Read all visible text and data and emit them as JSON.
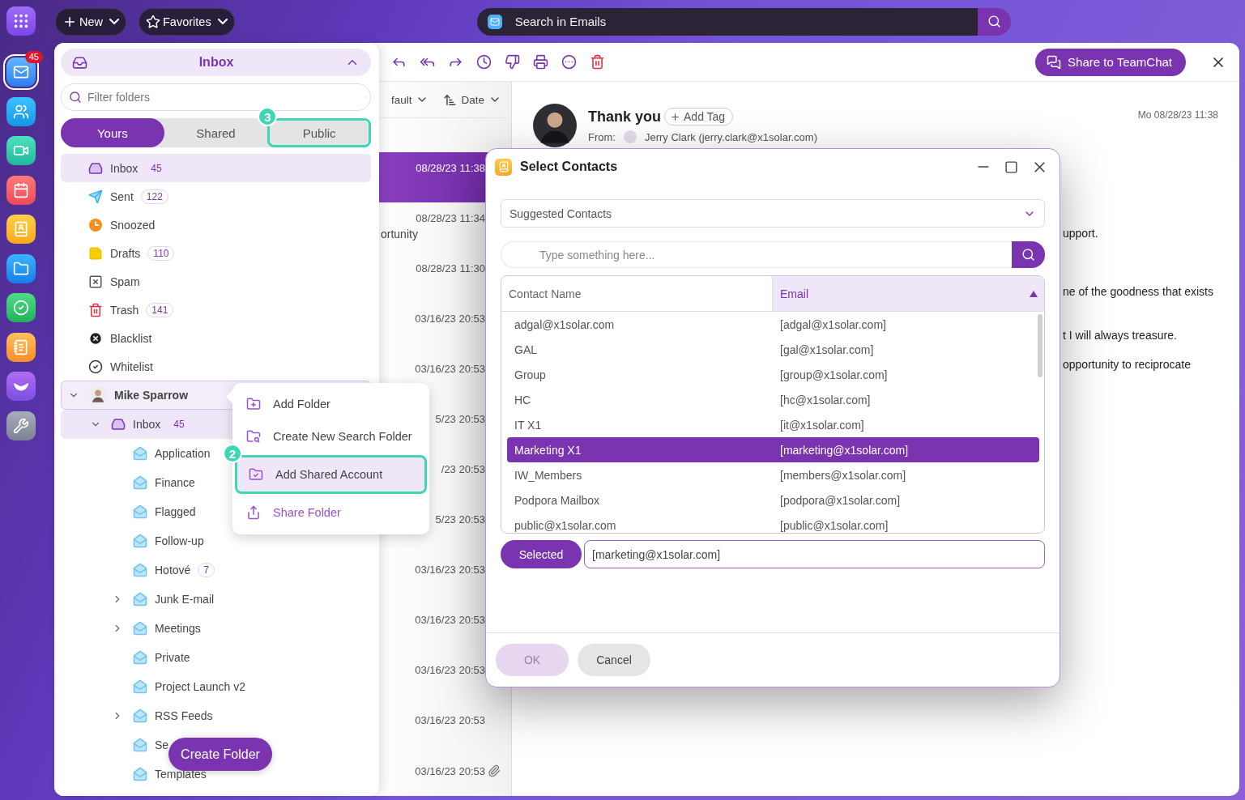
{
  "top_bar": {
    "new_label": "New",
    "favorites_label": "Favorites",
    "search_placeholder": "Search in Emails"
  },
  "app_rail": [
    {
      "kind": "mail",
      "selected": true,
      "badge": "45"
    },
    {
      "kind": "contacts",
      "selected": false
    },
    {
      "kind": "meetings",
      "selected": false
    },
    {
      "kind": "calendar",
      "selected": false
    },
    {
      "kind": "address_book",
      "selected": false
    },
    {
      "kind": "files",
      "selected": false
    },
    {
      "kind": "tasks",
      "selected": false
    },
    {
      "kind": "notes",
      "selected": false
    },
    {
      "kind": "stream",
      "selected": false
    },
    {
      "kind": "tools",
      "selected": false
    }
  ],
  "toolbar": {
    "share_button": "Share to TeamChat"
  },
  "message_list": {
    "view_filter": "fault",
    "sort_label": "Date",
    "rows": [
      {
        "date": "08/28/23 11:38",
        "selected": true
      },
      {
        "date": "08/28/23 11:34",
        "snippet": "ortunity",
        "selected": false
      },
      {
        "date": "08/28/23 11:30",
        "selected": false
      },
      {
        "date": "03/16/23 20:53",
        "selected": false
      },
      {
        "date": "03/16/23 20:53",
        "selected": false
      },
      {
        "date": "5/23 20:53",
        "selected": false
      },
      {
        "date": "/23 20:53",
        "selected": false
      },
      {
        "date": "5/23 20:53",
        "selected": false
      },
      {
        "date": "03/16/23 20:53",
        "selected": false
      },
      {
        "date": "03/16/23 20:53",
        "selected": false
      },
      {
        "date": "03/16/23 20:53",
        "selected": false
      },
      {
        "date": "03/16/23 20:53",
        "selected": false
      },
      {
        "date": "03/16/23 20:53",
        "selected": false,
        "attachment": true
      }
    ]
  },
  "reading_pane": {
    "subject": "Thank you",
    "add_tag": "Add Tag",
    "date": "Mo 08/28/23 11:38",
    "from_label": "From:",
    "from": "Jerry Clark (jerry.clark@x1solar.com)",
    "body_lines": [
      "upport.",
      "ne of the goodness that exists",
      "t I will always treasure.",
      "opportunity to reciprocate"
    ]
  },
  "folder_panel": {
    "title": "Inbox",
    "filter_placeholder": "Filter folders",
    "tabs": [
      {
        "label": "Yours",
        "selected": true
      },
      {
        "label": "Shared",
        "selected": false
      },
      {
        "label": "Public",
        "selected": false,
        "callout": "3"
      }
    ],
    "folders": [
      {
        "kind": "inbox",
        "label": "Inbox",
        "count": "45",
        "selected": true
      },
      {
        "kind": "sent",
        "label": "Sent",
        "count": "122",
        "selected": false
      },
      {
        "kind": "snoozed",
        "label": "Snoozed",
        "selected": false
      },
      {
        "kind": "drafts",
        "label": "Drafts",
        "count": "110",
        "selected": false
      },
      {
        "kind": "spam",
        "label": "Spam",
        "selected": false
      },
      {
        "kind": "trash",
        "label": "Trash",
        "count": "141",
        "selected": false
      },
      {
        "kind": "blacklist",
        "label": "Blacklist",
        "selected": false
      },
      {
        "kind": "whitelist",
        "label": "Whitelist",
        "selected": false
      }
    ],
    "accounts": [
      {
        "kind": "account",
        "label": "Mike Sparrow",
        "selected": true,
        "expanded": true,
        "children": [
          {
            "kind": "inbox",
            "label": "Inbox",
            "count": "45",
            "selected": true,
            "expanded": true,
            "children": [
              {
                "kind": "folder",
                "label": "Application",
                "selected": false
              },
              {
                "kind": "folder",
                "label": "Finance",
                "selected": false
              },
              {
                "kind": "folder",
                "label": "Flagged",
                "selected": false
              },
              {
                "kind": "folder",
                "label": "Follow-up",
                "selected": false
              },
              {
                "kind": "folder",
                "label": "Hotové",
                "count": "7",
                "selected": false
              },
              {
                "kind": "folder",
                "label": "Junk E-mail",
                "selected": false,
                "expanded": false
              },
              {
                "kind": "folder",
                "label": "Meetings",
                "selected": false,
                "expanded": false
              },
              {
                "kind": "folder",
                "label": "Private",
                "selected": false
              },
              {
                "kind": "folder",
                "label": "Project Launch v2",
                "selected": false
              },
              {
                "kind": "folder",
                "label": "RSS Feeds",
                "selected": false,
                "expanded": false
              },
              {
                "kind": "folder",
                "label": "Se",
                "selected": false
              },
              {
                "kind": "folder",
                "label": "Templates",
                "selected": false
              }
            ]
          }
        ]
      }
    ],
    "create_button": "Create Folder"
  },
  "context_menu": {
    "items": [
      {
        "kind": "add",
        "label": "Add Folder",
        "selected": false
      },
      {
        "kind": "search",
        "label": "Create New Search Folder",
        "selected": false
      },
      {
        "kind": "shared",
        "label": "Add Shared Account",
        "selected": true,
        "callout": "2"
      },
      {
        "kind": "share",
        "label": "Share Folder",
        "selected": false
      }
    ]
  },
  "dialog": {
    "title": "Select Contacts",
    "source": "Suggested Contacts",
    "search_placeholder": "Type something here...",
    "columns": [
      {
        "label": "Contact Name",
        "sorted": false
      },
      {
        "label": "Email",
        "sorted": true
      }
    ],
    "rows": [
      {
        "name": "adgal@x1solar.com",
        "email": "[adgal@x1solar.com]",
        "selected": false
      },
      {
        "name": "GAL",
        "email": "[gal@x1solar.com]",
        "selected": false
      },
      {
        "name": "Group",
        "email": "[group@x1solar.com]",
        "selected": false
      },
      {
        "name": "HC",
        "email": "[hc@x1solar.com]",
        "selected": false
      },
      {
        "name": "IT X1",
        "email": "[it@x1solar.com]",
        "selected": false
      },
      {
        "name": "Marketing X1",
        "email": "[marketing@x1solar.com]",
        "selected": true
      },
      {
        "name": "IW_Members",
        "email": "[members@x1solar.com]",
        "selected": false
      },
      {
        "name": "Podpora Mailbox",
        "email": "[podpora@x1solar.com]",
        "selected": false
      },
      {
        "name": "public@x1solar.com",
        "email": "[public@x1solar.com]",
        "selected": false
      }
    ],
    "selected_button": "Selected",
    "selected_value": "[marketing@x1solar.com]",
    "ok_button": {
      "label": "OK",
      "disabled": true
    },
    "cancel_button": "Cancel"
  }
}
